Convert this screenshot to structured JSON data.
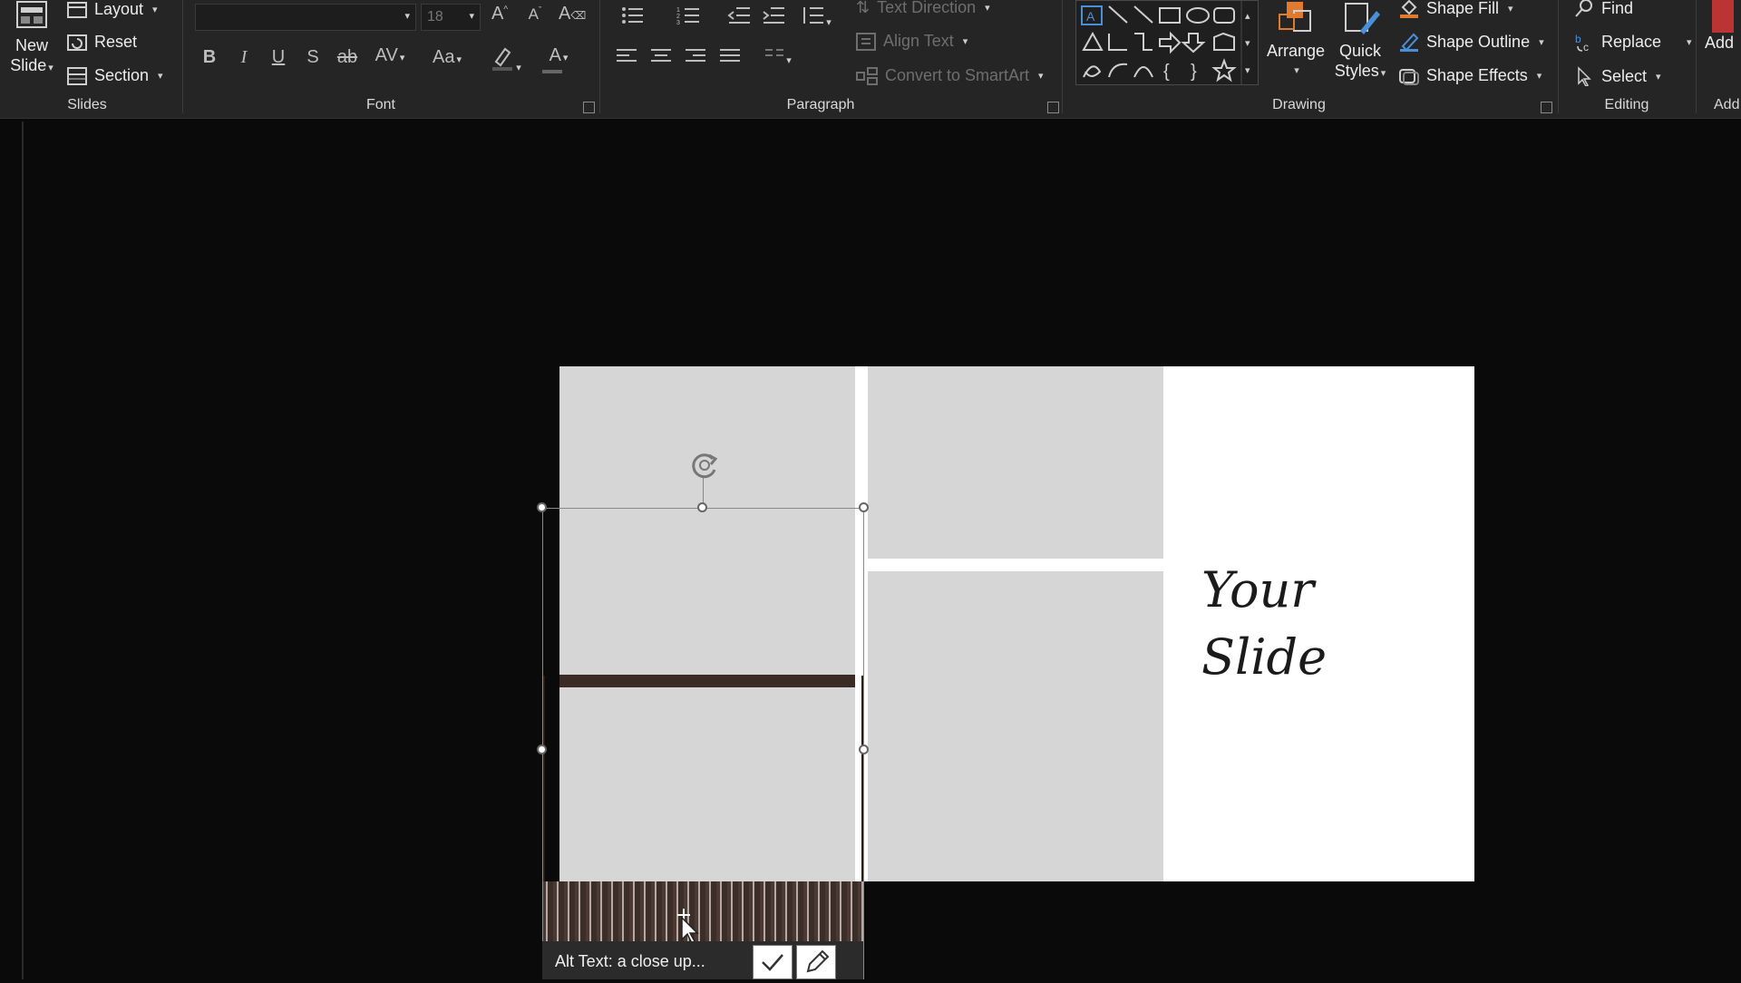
{
  "ribbon": {
    "slides_group": {
      "label": "Slides",
      "new_slide_line1": "New",
      "new_slide_line2": "Slide",
      "layout": "Layout",
      "reset": "Reset",
      "section": "Section"
    },
    "font_group": {
      "label": "Font",
      "font_name": "",
      "font_size": "18",
      "change_case": "Aa"
    },
    "paragraph_group": {
      "label": "Paragraph",
      "text_direction": "Text Direction",
      "align_text": "Align Text",
      "convert_smartart": "Convert to SmartArt"
    },
    "drawing_group": {
      "label": "Drawing",
      "arrange": "Arrange",
      "quick_styles_line1": "Quick",
      "quick_styles_line2": "Styles",
      "shape_fill": "Shape Fill",
      "shape_outline": "Shape Outline",
      "shape_effects": "Shape Effects"
    },
    "editing_group": {
      "label": "Editing",
      "find": "Find",
      "replace": "Replace",
      "select": "Select"
    },
    "addins_group": {
      "label": "Add",
      "addins": "Add"
    }
  },
  "slide": {
    "title_line1": "Your",
    "title_line2": "Slide"
  },
  "alt_text": {
    "label": "Alt Text: a close up..."
  },
  "colors": {
    "ribbon_bg": "#252525",
    "app_bg": "#0a0a0a",
    "placeholder": "#d6d6d6",
    "accent_orange": "#e07a2f",
    "accent_blue": "#4a90d9"
  }
}
